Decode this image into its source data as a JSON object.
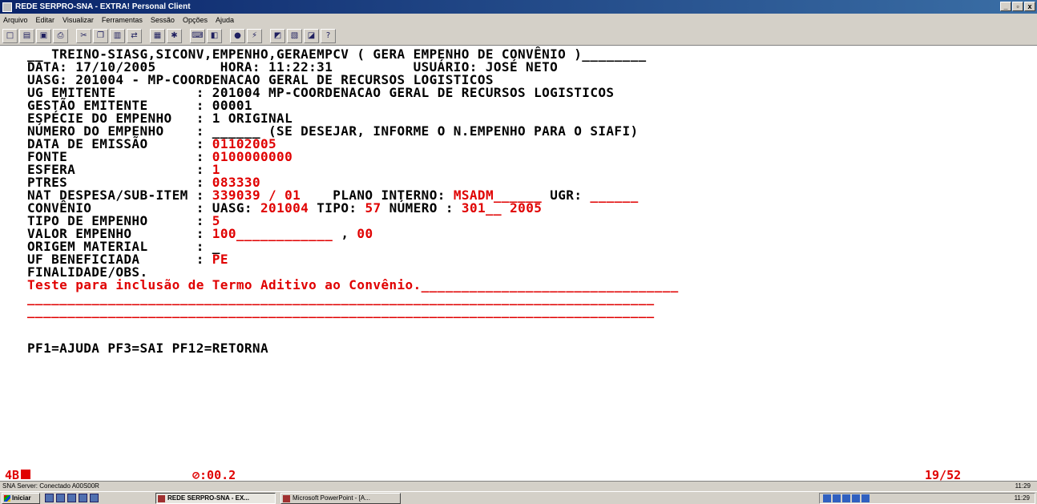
{
  "window": {
    "title": "REDE SERPRO-SNA - EXTRA! Personal Client",
    "controls": [
      "_",
      "▫",
      "x"
    ]
  },
  "menu": [
    "Arquivo",
    "Editar",
    "Visualizar",
    "Ferramentas",
    "Sessão",
    "Opções",
    "Ajuda"
  ],
  "toolbar": {
    "icons": [
      "new-icon",
      "open-icon",
      "save-icon",
      "print-icon",
      "cut-icon",
      "copy-icon",
      "paste-icon",
      "transfer-icon",
      "session-icon",
      "macro-icon",
      "keyboard-icon",
      "color-icon",
      "record-icon",
      "connect-icon",
      "hotspot-icon",
      "settings-icon",
      "help-icon"
    ]
  },
  "terminal": {
    "header": {
      "title": "__ TREINO-SIASG,SICONV,EMPENHO,GERAEMPCV ( GERA EMPENHO DE CONVÊNIO )________",
      "date_line": "DATA: 17/10/2005        HORA: 11:22:31          USUÁRIO: JOSÉ NETO",
      "uasg_line": "UASG: 201004 - MP-COORDENACAO GERAL DE RECURSOS LOGISTICOS"
    },
    "fields": [
      {
        "label": "UG EMITENTE          ",
        "value_black": "201004 MP-COORDENACAO GERAL DE RECURSOS LOGISTICOS",
        "value_red": ""
      },
      {
        "label": "GESTÃO EMITENTE      ",
        "value_black": "00001",
        "value_red": ""
      },
      {
        "label": "ESPÉCIE DO EMPENHO   ",
        "value_black": "1 ORIGINAL",
        "value_red": ""
      },
      {
        "label": "NÚMERO DO EMPENHO    ",
        "value_black": "______ (SE DESEJAR, INFORME O N.EMPENHO PARA O SIAFI)",
        "value_red": ""
      },
      {
        "label": "DATA DE EMISSÃO      ",
        "value_black": "",
        "value_red": "01102005"
      },
      {
        "label": "FONTE                ",
        "value_black": "",
        "value_red": "0100000000"
      },
      {
        "label": "ESFERA               ",
        "value_black": "",
        "value_red": "1"
      },
      {
        "label": "PTRES                ",
        "value_black": "",
        "value_red": "083330"
      }
    ],
    "nat_despesa": {
      "label": "NAT DESPESA/SUB-ITEM ",
      "value": "339039 / 01",
      "plano_label": "PLANO INTERNO:",
      "plano_value": "MSADM______",
      "ugr_label": "UGR:",
      "ugr_value": "______"
    },
    "convenio": {
      "label": "CONVÊNIO             ",
      "uasg_label": "UASG:",
      "uasg_value": "201004",
      "tipo_label": "TIPO:",
      "tipo_value": "57",
      "numero_label": "NÚMERO :",
      "numero_value": "301__",
      "ano_value": "2005"
    },
    "tipo_empenho": {
      "label": "TIPO DE EMPENHO      ",
      "value": "5"
    },
    "valor_empenho": {
      "label": "VALOR EMPENHO        ",
      "int_value": "100____________",
      "sep": ",",
      "dec_value": "00"
    },
    "origem_material": {
      "label": "ORIGEM MATERIAL      ",
      "value": "_"
    },
    "uf_beneficiada": {
      "label": "UF BENEFICIADA       ",
      "value": "PE"
    },
    "finalidade_label": "FINALIDADE/OBS.",
    "obs_line1": "Teste para inclusão de Termo Aditivo ao Convênio.________________________________",
    "obs_line2": "______________________________________________________________________________",
    "obs_line3": "______________________________________________________________________________",
    "pf_keys": "PF1=AJUDA PF3=SAI PF12=RETORNA"
  },
  "status": {
    "indicator": "4B",
    "timer": "⊘:00.2",
    "cursor_pos": "19/52"
  },
  "sna_status": {
    "text": "SNA Server: Conectado A00S00R",
    "clock": "11:29"
  },
  "taskbar": {
    "start_label": "Iniciar",
    "tasks": [
      {
        "label": "REDE SERPRO-SNA - EX...",
        "active": true
      },
      {
        "label": "Microsoft PowerPoint - [A...",
        "active": false
      }
    ],
    "time": "11:29"
  }
}
